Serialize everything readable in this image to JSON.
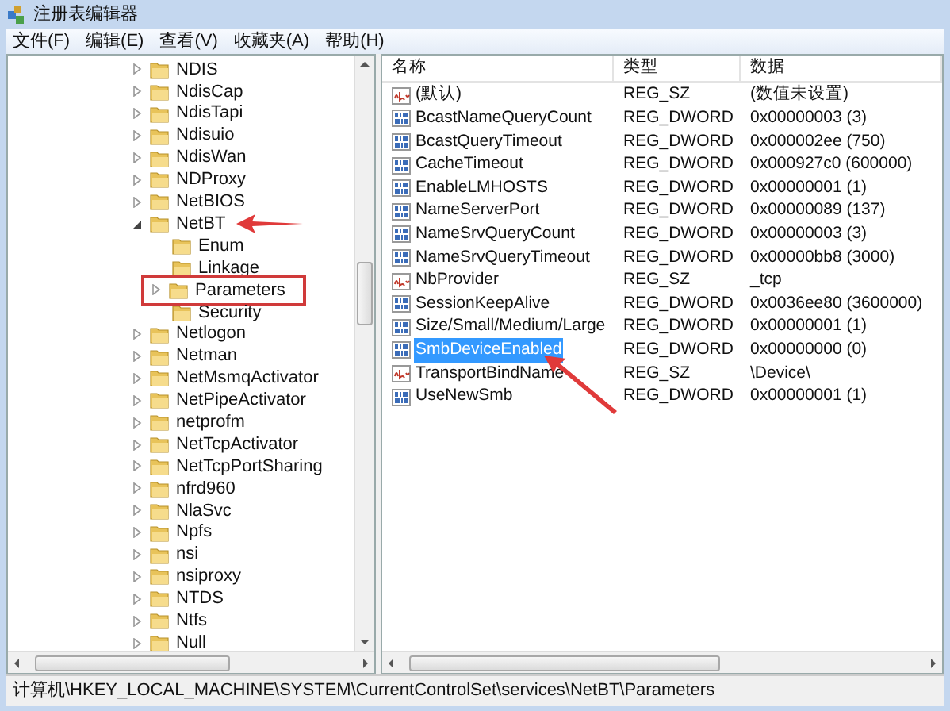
{
  "window": {
    "title": "注册表编辑器"
  },
  "menu": [
    "文件(F)",
    "编辑(E)",
    "查看(V)",
    "收藏夹(A)",
    "帮助(H)"
  ],
  "tree": [
    {
      "label": "NDIS",
      "expanded": false
    },
    {
      "label": "NdisCap",
      "expanded": false
    },
    {
      "label": "NdisTapi",
      "expanded": false
    },
    {
      "label": "Ndisuio",
      "expanded": false
    },
    {
      "label": "NdisWan",
      "expanded": false
    },
    {
      "label": "NDProxy",
      "expanded": false
    },
    {
      "label": "NetBIOS",
      "expanded": false
    },
    {
      "label": "NetBT",
      "expanded": true,
      "arrow": true,
      "children": [
        {
          "label": "Enum",
          "leaf": true
        },
        {
          "label": "Linkage",
          "leaf": true
        },
        {
          "label": "Parameters",
          "expanded": false,
          "boxed": true
        },
        {
          "label": "Security",
          "leaf": true
        }
      ]
    },
    {
      "label": "Netlogon",
      "expanded": false
    },
    {
      "label": "Netman",
      "expanded": false
    },
    {
      "label": "NetMsmqActivator",
      "expanded": false
    },
    {
      "label": "NetPipeActivator",
      "expanded": false
    },
    {
      "label": "netprofm",
      "expanded": false
    },
    {
      "label": "NetTcpActivator",
      "expanded": false
    },
    {
      "label": "NetTcpPortSharing",
      "expanded": false
    },
    {
      "label": "nfrd960",
      "expanded": false
    },
    {
      "label": "NlaSvc",
      "expanded": false
    },
    {
      "label": "Npfs",
      "expanded": false
    },
    {
      "label": "nsi",
      "expanded": false
    },
    {
      "label": "nsiproxy",
      "expanded": false
    },
    {
      "label": "NTDS",
      "expanded": false
    },
    {
      "label": "Ntfs",
      "expanded": false
    },
    {
      "label": "Null",
      "expanded": false
    }
  ],
  "values": {
    "columns": [
      "名称",
      "类型",
      "数据"
    ],
    "rows": [
      {
        "kind": "string",
        "name": "(默认)",
        "type": "REG_SZ",
        "data": "(数值未设置)",
        "selected": false
      },
      {
        "kind": "dword",
        "name": "BcastNameQueryCount",
        "type": "REG_DWORD",
        "data": "0x00000003 (3)",
        "selected": false
      },
      {
        "kind": "dword",
        "name": "BcastQueryTimeout",
        "type": "REG_DWORD",
        "data": "0x000002ee (750)",
        "selected": false
      },
      {
        "kind": "dword",
        "name": "CacheTimeout",
        "type": "REG_DWORD",
        "data": "0x000927c0 (600000)",
        "selected": false
      },
      {
        "kind": "dword",
        "name": "EnableLMHOSTS",
        "type": "REG_DWORD",
        "data": "0x00000001 (1)",
        "selected": false
      },
      {
        "kind": "dword",
        "name": "NameServerPort",
        "type": "REG_DWORD",
        "data": "0x00000089 (137)",
        "selected": false
      },
      {
        "kind": "dword",
        "name": "NameSrvQueryCount",
        "type": "REG_DWORD",
        "data": "0x00000003 (3)",
        "selected": false
      },
      {
        "kind": "dword",
        "name": "NameSrvQueryTimeout",
        "type": "REG_DWORD",
        "data": "0x00000bb8 (3000)",
        "selected": false
      },
      {
        "kind": "string",
        "name": "NbProvider",
        "type": "REG_SZ",
        "data": "_tcp",
        "selected": false
      },
      {
        "kind": "dword",
        "name": "SessionKeepAlive",
        "type": "REG_DWORD",
        "data": "0x0036ee80 (3600000)",
        "selected": false
      },
      {
        "kind": "dword",
        "name": "Size/Small/Medium/Large",
        "type": "REG_DWORD",
        "data": "0x00000001 (1)",
        "selected": false
      },
      {
        "kind": "dword",
        "name": "SmbDeviceEnabled",
        "type": "REG_DWORD",
        "data": "0x00000000 (0)",
        "selected": true,
        "arrow": true
      },
      {
        "kind": "string",
        "name": "TransportBindName",
        "type": "REG_SZ",
        "data": "\\Device\\",
        "selected": false
      },
      {
        "kind": "dword",
        "name": "UseNewSmb",
        "type": "REG_DWORD",
        "data": "0x00000001 (1)",
        "selected": false
      }
    ]
  },
  "status_bar": "计算机\\HKEY_LOCAL_MACHINE\\SYSTEM\\CurrentControlSet\\services\\NetBT\\Parameters"
}
